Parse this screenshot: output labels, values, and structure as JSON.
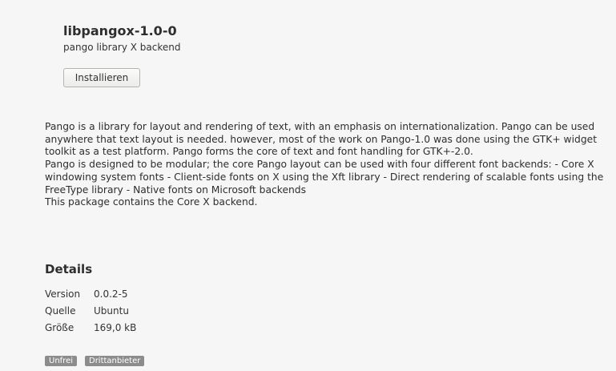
{
  "app": {
    "name": "libpangox-1.0-0",
    "summary": "pango library X backend",
    "install_label": "Installieren"
  },
  "description": [
    "Pango is a library for layout and rendering of text, with an emphasis on internationalization. Pango can be used anywhere that text layout is needed. however, most of the work on Pango-1.0 was done using the GTK+ widget toolkit as a test platform. Pango forms the core of text and font handling for GTK+-2.0.",
    "Pango is designed to be modular; the core Pango layout can be used with four different font backends: - Core X windowing system fonts - Client-side fonts on X using the Xft library - Direct rendering of scalable fonts using the FreeType library - Native fonts on Microsoft backends",
    "This package contains the Core X backend."
  ],
  "details": {
    "heading": "Details",
    "rows": [
      {
        "label": "Version",
        "value": "0.0.2-5"
      },
      {
        "label": "Quelle",
        "value": "Ubuntu"
      },
      {
        "label": "Größe",
        "value": "169,0 kB"
      }
    ]
  },
  "badges": [
    "Unfrei",
    "Drittanbieter"
  ],
  "colors": {
    "background": "#f6f6f6",
    "badge": "#8c8c8c",
    "text": "#2e2e2e"
  }
}
